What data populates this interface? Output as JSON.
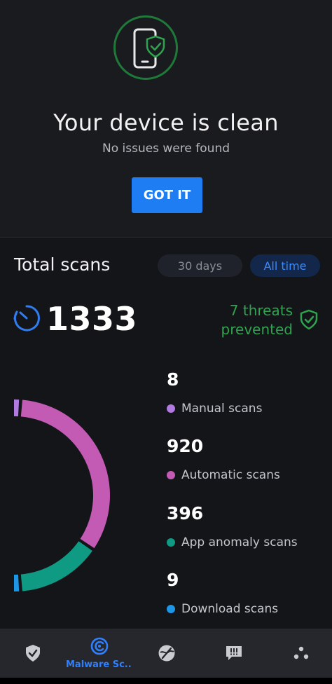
{
  "hero": {
    "title": "Your device is clean",
    "subtitle": "No issues were found",
    "button_label": "GOT IT",
    "icon": "phone-shield-icon"
  },
  "stats": {
    "title": "Total scans",
    "filters": [
      {
        "label": "30 days",
        "selected": false
      },
      {
        "label": "All time",
        "selected": true
      }
    ],
    "total_count": "1333",
    "threats_line1": "7 threats",
    "threats_line2": "prevented",
    "breakdown": [
      {
        "value": "8",
        "label": "Manual scans",
        "color": "#b07ae0"
      },
      {
        "value": "920",
        "label": "Automatic scans",
        "color": "#c35ab4"
      },
      {
        "value": "396",
        "label": "App anomaly scans",
        "color": "#0f9a84"
      },
      {
        "value": "9",
        "label": "Download scans",
        "color": "#1e96e6"
      }
    ]
  },
  "chart_data": {
    "type": "pie",
    "categories": [
      "Manual scans",
      "Automatic scans",
      "App anomaly scans",
      "Download scans"
    ],
    "values": [
      8,
      920,
      396,
      9
    ],
    "colors": [
      "#b07ae0",
      "#c35ab4",
      "#0f9a84",
      "#1e96e6"
    ]
  },
  "nav": {
    "items": [
      {
        "icon": "shield-check-icon",
        "label": ""
      },
      {
        "icon": "malware-scan-icon",
        "label": "Malware Sc...",
        "active": true
      },
      {
        "icon": "web-protection-icon",
        "label": ""
      },
      {
        "icon": "alerts-icon",
        "label": ""
      },
      {
        "icon": "more-icon",
        "label": ""
      }
    ]
  },
  "colors": {
    "accent": "#1e7df2",
    "success": "#2ea44f",
    "background": "#1a1b1f",
    "panel": "#141519"
  }
}
